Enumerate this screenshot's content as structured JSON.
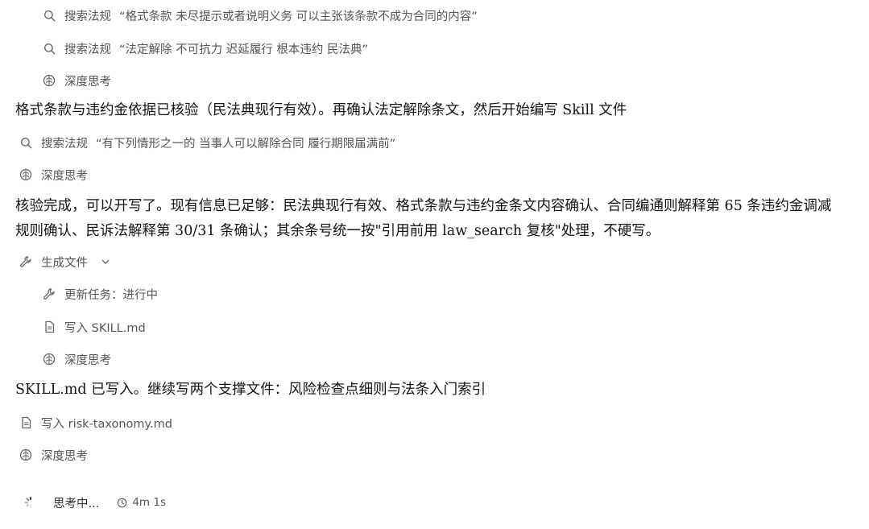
{
  "steps_top": [
    {
      "label": "搜索法规",
      "query": "“格式条款 未尽提示或者说明义务 可以主张该条款不成为合同的内容”"
    },
    {
      "label": "搜索法规",
      "query": "“法定解除 不可抗力 迟延履行 根本违约 民法典”"
    },
    {
      "label": "深度思考"
    }
  ],
  "paragraph1": "格式条款与违约金依据已核验（民法典现行有效）。再确认法定解除条文，然后开始编写 Skill 文件",
  "step_search3": {
    "label": "搜索法规",
    "query": "“有下列情形之一的 当事人可以解除合同 履行期限届满前”"
  },
  "think2": "深度思考",
  "paragraph2": "核验完成，可以开写了。现有信息已足够：民法典现行有效、格式条款与违约金条文内容确认、合同编通则解释第 65 条违约金调减规则确认、民诉法解释第 30/31 条确认；其余条号统一按\"引用前用 law_search 复核\"处理，不硬写。",
  "generate_files": {
    "label": "生成文件",
    "substeps": [
      {
        "label": "更新任务：进行中",
        "icon": "wrench-icon"
      },
      {
        "label": "写入 SKILL.md",
        "icon": "document-icon"
      },
      {
        "label": "深度思考",
        "icon": "brain-icon"
      }
    ]
  },
  "paragraph3": "SKILL.md 已写入。继续写两个支撑文件：风险检查点细则与法条入门索引",
  "write_risk": "写入 risk-taxonomy.md",
  "think3": "深度思考",
  "status": {
    "label": "思考中...",
    "time": "4m 1s"
  }
}
